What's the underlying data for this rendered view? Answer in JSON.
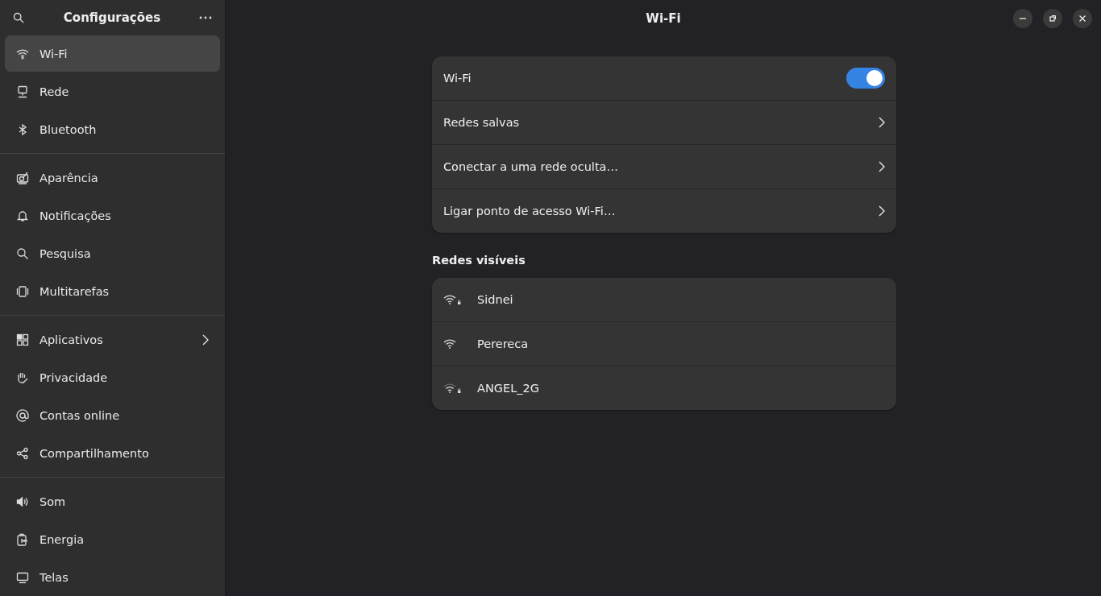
{
  "sidebar": {
    "title": "Configurações",
    "groups": [
      {
        "items": [
          {
            "label": "Wi-Fi",
            "selected": true,
            "has_submenu": false
          },
          {
            "label": "Rede",
            "selected": false,
            "has_submenu": false
          },
          {
            "label": "Bluetooth",
            "selected": false,
            "has_submenu": false
          }
        ]
      },
      {
        "items": [
          {
            "label": "Aparência",
            "selected": false,
            "has_submenu": false
          },
          {
            "label": "Notificações",
            "selected": false,
            "has_submenu": false
          },
          {
            "label": "Pesquisa",
            "selected": false,
            "has_submenu": false
          },
          {
            "label": "Multitarefas",
            "selected": false,
            "has_submenu": false
          }
        ]
      },
      {
        "items": [
          {
            "label": "Aplicativos",
            "selected": false,
            "has_submenu": true
          },
          {
            "label": "Privacidade",
            "selected": false,
            "has_submenu": false
          },
          {
            "label": "Contas online",
            "selected": false,
            "has_submenu": false
          },
          {
            "label": "Compartilhamento",
            "selected": false,
            "has_submenu": false
          }
        ]
      },
      {
        "items": [
          {
            "label": "Som",
            "selected": false,
            "has_submenu": false
          },
          {
            "label": "Energia",
            "selected": false,
            "has_submenu": false
          },
          {
            "label": "Telas",
            "selected": false,
            "has_submenu": false
          }
        ]
      }
    ]
  },
  "window": {
    "title": "Wi-Fi"
  },
  "settings": [
    {
      "kind": "switch",
      "label": "Wi-Fi",
      "on": true
    },
    {
      "kind": "link",
      "label": "Redes salvas"
    },
    {
      "kind": "link",
      "label": "Conectar a uma rede oculta…"
    },
    {
      "kind": "link",
      "label": "Ligar ponto de acesso Wi-Fi…"
    }
  ],
  "visible_networks": {
    "heading": "Redes visíveis",
    "networks": [
      {
        "name": "Sidnei",
        "secured": true,
        "weak_signal": false
      },
      {
        "name": "Perereca",
        "secured": false,
        "weak_signal": false
      },
      {
        "name": "ANGEL_2G",
        "secured": true,
        "weak_signal": true
      }
    ]
  }
}
